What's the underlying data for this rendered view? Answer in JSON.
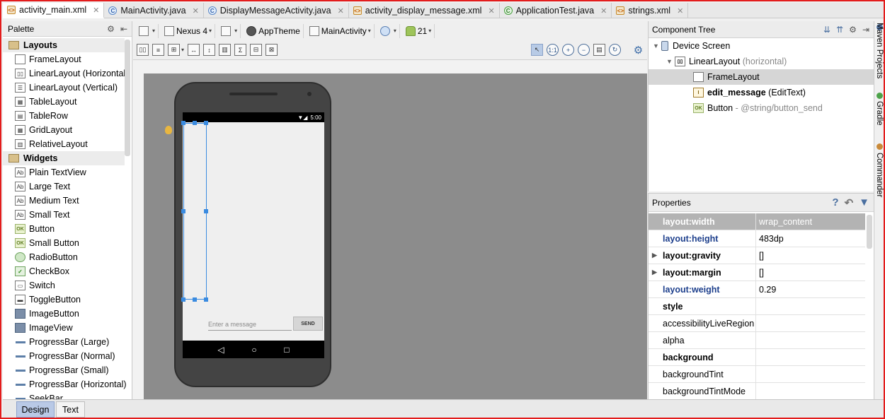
{
  "tabs": [
    {
      "label": "activity_main.xml",
      "kind": "xml",
      "active": true
    },
    {
      "label": "MainActivity.java",
      "kind": "java",
      "active": false
    },
    {
      "label": "DisplayMessageActivity.java",
      "kind": "java",
      "active": false
    },
    {
      "label": "activity_display_message.xml",
      "kind": "xml",
      "active": false
    },
    {
      "label": "ApplicationTest.java",
      "kind": "test",
      "active": false
    },
    {
      "label": "strings.xml",
      "kind": "xml",
      "active": false
    }
  ],
  "palette": {
    "title": "Palette",
    "layouts_label": "Layouts",
    "layouts": [
      "FrameLayout",
      "LinearLayout (Horizontal)",
      "LinearLayout (Vertical)",
      "TableLayout",
      "TableRow",
      "GridLayout",
      "RelativeLayout"
    ],
    "widgets_label": "Widgets",
    "widgets": [
      {
        "label": "Plain TextView",
        "icon": "Ab"
      },
      {
        "label": "Large Text",
        "icon": "Ab"
      },
      {
        "label": "Medium Text",
        "icon": "Ab"
      },
      {
        "label": "Small Text",
        "icon": "Ab"
      },
      {
        "label": "Button",
        "icon": "OK"
      },
      {
        "label": "Small Button",
        "icon": "OK"
      },
      {
        "label": "RadioButton",
        "icon": "radio"
      },
      {
        "label": "CheckBox",
        "icon": "check"
      },
      {
        "label": "Switch",
        "icon": "switch"
      },
      {
        "label": "ToggleButton",
        "icon": "toggle"
      },
      {
        "label": "ImageButton",
        "icon": "image"
      },
      {
        "label": "ImageView",
        "icon": "image"
      },
      {
        "label": "ProgressBar (Large)",
        "icon": "bar"
      },
      {
        "label": "ProgressBar (Normal)",
        "icon": "bar"
      },
      {
        "label": "ProgressBar (Small)",
        "icon": "bar"
      },
      {
        "label": "ProgressBar (Horizontal)",
        "icon": "bar"
      },
      {
        "label": "SeekBar",
        "icon": "bar"
      }
    ]
  },
  "toolbar": {
    "device": "Nexus 4",
    "theme": "AppTheme",
    "activity": "MainActivity",
    "api": "21"
  },
  "preview": {
    "time": "5:00",
    "edit_hint": "Enter a message",
    "send_label": "SEND"
  },
  "component_tree": {
    "title": "Component Tree",
    "device_screen": "Device Screen",
    "linear_layout": "LinearLayout",
    "linear_layout_sub": "(horizontal)",
    "frame_layout": "FrameLayout",
    "edit_message": "edit_message",
    "edit_message_sub": "(EditText)",
    "button": "Button",
    "button_sub": "- @string/button_send"
  },
  "properties": {
    "title": "Properties",
    "rows": [
      {
        "name": "layout:width",
        "value": "wrap_content",
        "style": "hl"
      },
      {
        "name": "layout:height",
        "value": "483dp",
        "style": "blue"
      },
      {
        "name": "layout:gravity",
        "value": "[]",
        "style": "bold",
        "expand": true
      },
      {
        "name": "layout:margin",
        "value": "[]",
        "style": "bold",
        "expand": true
      },
      {
        "name": "layout:weight",
        "value": "0.29",
        "style": "blue"
      },
      {
        "name": "style",
        "value": "",
        "style": "bold"
      },
      {
        "name": "accessibilityLiveRegion",
        "value": "",
        "style": ""
      },
      {
        "name": "alpha",
        "value": "",
        "style": ""
      },
      {
        "name": "background",
        "value": "",
        "style": "bold"
      },
      {
        "name": "backgroundTint",
        "value": "",
        "style": ""
      },
      {
        "name": "backgroundTintMode",
        "value": "",
        "style": ""
      }
    ]
  },
  "side_tabs": {
    "maven": "Maven Projects",
    "gradle": "Gradle",
    "commander": "Commander"
  },
  "bottom_tabs": {
    "design": "Design",
    "text": "Text"
  },
  "colors": {
    "accent": "#3a8be0",
    "frame_border": "#e31c1c",
    "selected_tab": "#b9c9e6"
  }
}
